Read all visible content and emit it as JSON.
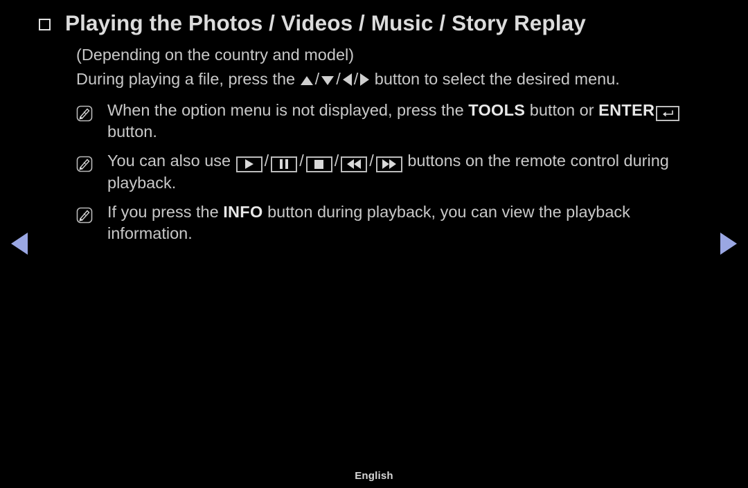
{
  "screen": {
    "background_color": "#000000",
    "text_color": "#c8c8c8",
    "accent_color": "#9aa7e3"
  },
  "header": {
    "bullet_icon": "square-bullet-icon",
    "title": "Playing the Photos / Videos / Music / Story Replay"
  },
  "intro": {
    "line1": "(Depending on the country and model)",
    "line2_before": "During playing a file, press the",
    "line2_after": "button to select the desired menu.",
    "direction_keys": [
      "arrow-up-icon",
      "arrow-down-icon",
      "arrow-left-icon",
      "arrow-right-icon"
    ]
  },
  "notes": [
    {
      "icon": "note-pencil-icon",
      "segments": [
        {
          "type": "text",
          "value": "When the option menu is not displayed, press the "
        },
        {
          "type": "bold",
          "value": "TOOLS"
        },
        {
          "type": "text",
          "value": " button or "
        },
        {
          "type": "bold",
          "value": "ENTER"
        },
        {
          "type": "key",
          "value": "enter-key-icon"
        },
        {
          "type": "text",
          "value": " button."
        }
      ],
      "plain_text": "When the option menu is not displayed, press the TOOLS button or ENTER button."
    },
    {
      "icon": "note-pencil-icon",
      "segments": [
        {
          "type": "text",
          "value": "You can also use "
        },
        {
          "type": "keys",
          "value": [
            "play-icon",
            "pause-icon",
            "stop-icon",
            "rewind-icon",
            "fast-forward-icon"
          ]
        },
        {
          "type": "text",
          "value": " buttons on the remote control during playback."
        }
      ],
      "plain_text": "You can also use buttons on the remote control during playback."
    },
    {
      "icon": "note-pencil-icon",
      "segments": [
        {
          "type": "text",
          "value": "If you press the "
        },
        {
          "type": "bold",
          "value": "INFO"
        },
        {
          "type": "text",
          "value": " button during playback, you can view the playback information."
        }
      ],
      "plain_text": "If you press the INFO button during playback, you can view the playback information."
    }
  ],
  "nav": {
    "prev_label": "previous-page-arrow",
    "next_label": "next-page-arrow"
  },
  "footer": {
    "language": "English"
  }
}
